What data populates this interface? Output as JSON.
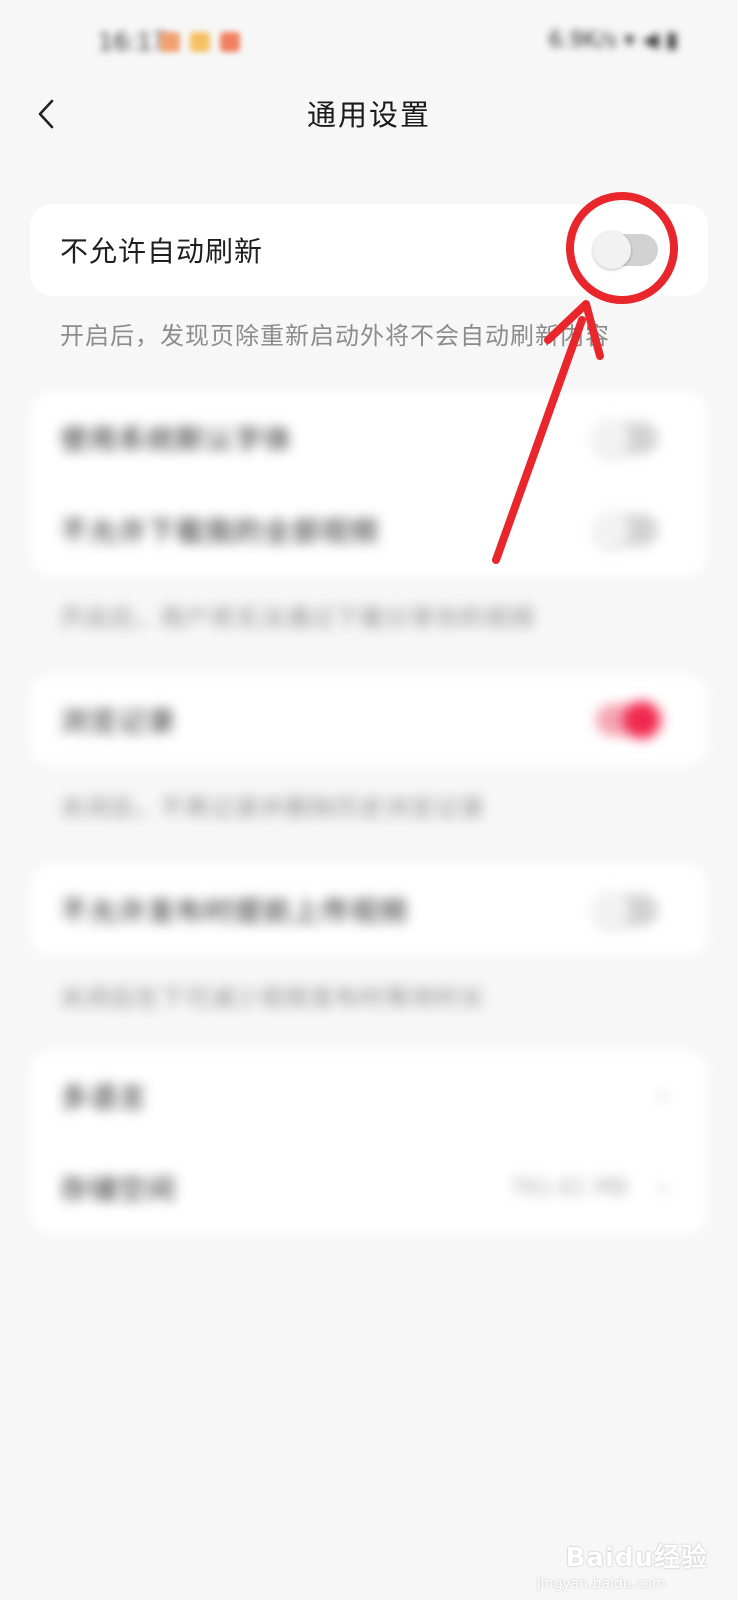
{
  "status_bar": {
    "time": "16:17",
    "right": "6.9K/s ▾ ◀ ▮"
  },
  "header": {
    "title": "通用设置"
  },
  "auto_refresh": {
    "label": "不允许自动刷新",
    "enabled": false,
    "hint": "开启后，发现页除重新启动外将不会自动刷新内容"
  },
  "section2": {
    "items": [
      {
        "label": "使用系统默认字体"
      },
      {
        "label": "不允许下载我的全部视频"
      }
    ],
    "hint": "开启后，用户将无法通过下载分享你的视频"
  },
  "section3": {
    "label": "浏览记录",
    "hint": "关闭后，不再记录并删除历史浏览记录"
  },
  "section4": {
    "label": "不允许发布时提前上传视频",
    "hint": "关闭后在下可减少视频发布时等待时长"
  },
  "section5": {
    "items": [
      {
        "label": "多语言"
      },
      {
        "label": "存储空间",
        "value": "761.61 MB"
      }
    ]
  },
  "watermark": {
    "brand": "Baidu经验",
    "url": "jingyan.baidu.com"
  },
  "colors": {
    "accent": "#f0294e",
    "annotation": "#e8262b"
  }
}
